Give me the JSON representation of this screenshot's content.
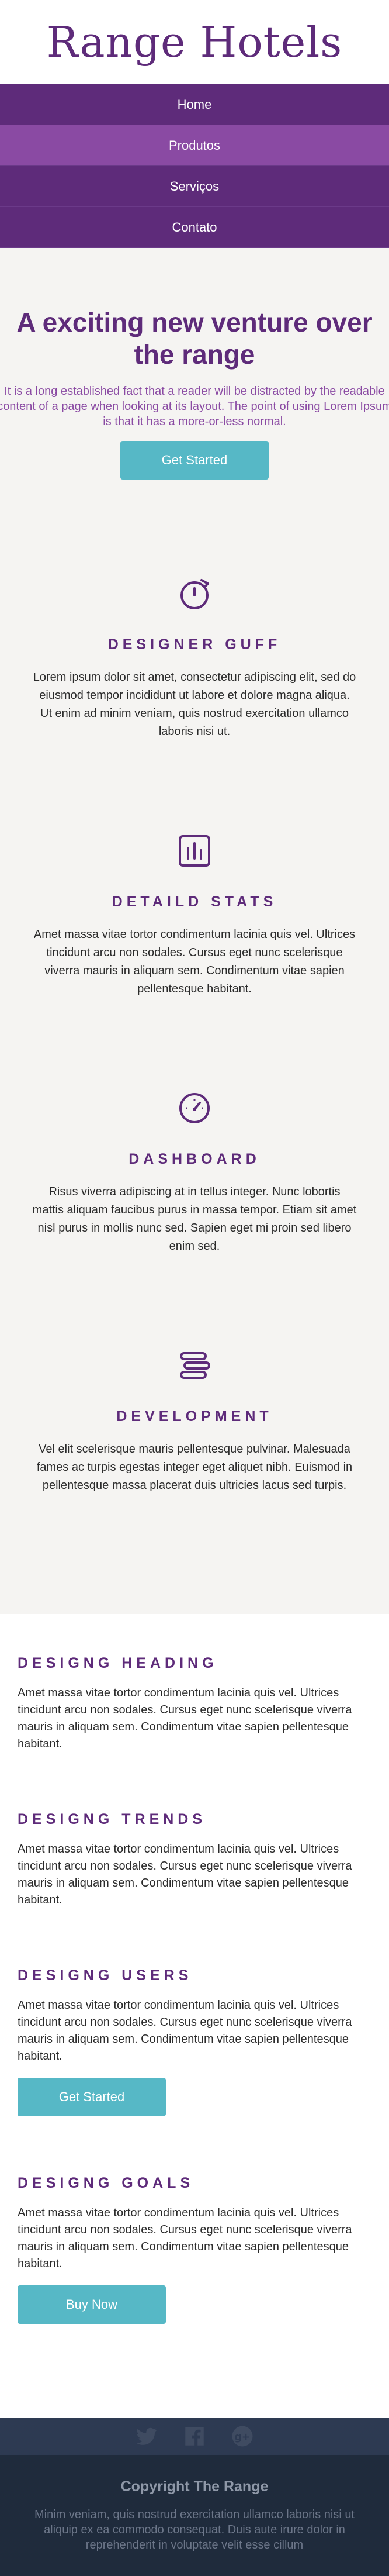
{
  "header": {
    "logo": "Range Hotels"
  },
  "nav": {
    "items": [
      {
        "label": "Home"
      },
      {
        "label": "Produtos"
      },
      {
        "label": "Serviços"
      },
      {
        "label": "Contato"
      }
    ]
  },
  "hero": {
    "title": "A exciting new venture over the range",
    "text": "It is a long established fact that a reader will be distracted by the readable content of a page when looking at its layout. The point of using Lorem Ipsum is that it has a more-or-less normal.",
    "button": "Get Started"
  },
  "features": [
    {
      "icon": "stopwatch-icon",
      "title": "DESIGNER GUFF",
      "text": "Lorem ipsum dolor sit amet, consectetur adipiscing elit, sed do eiusmod tempor incididunt ut labore et dolore magna aliqua. Ut enim ad minim veniam, quis nostrud exercitation ullamco laboris nisi ut."
    },
    {
      "icon": "bar-chart-icon",
      "title": "DETAILD STATS",
      "text": "Amet massa vitae tortor condimentum lacinia quis vel. Ultrices tincidunt arcu non sodales. Cursus eget nunc scelerisque viverra mauris in aliquam sem. Condimentum vitae sapien pellentesque habitant."
    },
    {
      "icon": "dashboard-gauge-icon",
      "title": "DASHBOARD",
      "text": "Risus viverra adipiscing at in tellus integer. Nunc lobortis mattis aliquam faucibus purus in massa tempor. Etiam sit amet nisl purus in mollis nunc sed. Sapien eget mi proin sed libero enim sed."
    },
    {
      "icon": "stack-layers-icon",
      "title": "DEVELOPMENT",
      "text": "Vel elit scelerisque mauris pellentesque pulvinar. Malesuada fames ac turpis egestas integer eget aliquet nibh. Euismod in pellentesque massa placerat duis ultricies lacus sed turpis."
    }
  ],
  "designs": [
    {
      "title": "DESIGNG HEADING",
      "text": "Amet massa vitae tortor condimentum lacinia quis vel. Ultrices tincidunt arcu non sodales. Cursus eget nunc scelerisque viverra mauris in aliquam sem. Condimentum vitae sapien pellentesque habitant."
    },
    {
      "title": "DESIGNG TRENDS",
      "text": "Amet massa vitae tortor condimentum lacinia quis vel. Ultrices tincidunt arcu non sodales. Cursus eget nunc scelerisque viverra mauris in aliquam sem. Condimentum vitae sapien pellentesque habitant."
    },
    {
      "title": "DESIGNG USERS",
      "text": "Amet massa vitae tortor condimentum lacinia quis vel. Ultrices tincidunt arcu non sodales. Cursus eget nunc scelerisque viverra mauris in aliquam sem. Condimentum vitae sapien pellentesque habitant.",
      "button": "Get Started"
    },
    {
      "title": "DESIGNG GOALS",
      "text": "Amet massa vitae tortor condimentum lacinia quis vel. Ultrices tincidunt arcu non sodales. Cursus eget nunc scelerisque viverra mauris in aliquam sem. Condimentum vitae sapien pellentesque habitant.",
      "button": "Buy Now"
    }
  ],
  "footer": {
    "icons": [
      "twitter-icon",
      "facebook-icon",
      "google-plus-icon"
    ],
    "title": "Copyright The Range",
    "text": "Minim veniam, quis nostrud exercitation ullamco laboris nisi ut aliquip ex ea commodo consequat. Duis aute irure dolor in reprehenderit in voluptate velit esse cillum"
  },
  "colors": {
    "brand_purple": "#5e2b7a",
    "nav_active": "#8a4aa3",
    "button_teal": "#56b8c6",
    "section_bg": "#f5f4f2",
    "footer_bg": "#1f2b3c"
  }
}
